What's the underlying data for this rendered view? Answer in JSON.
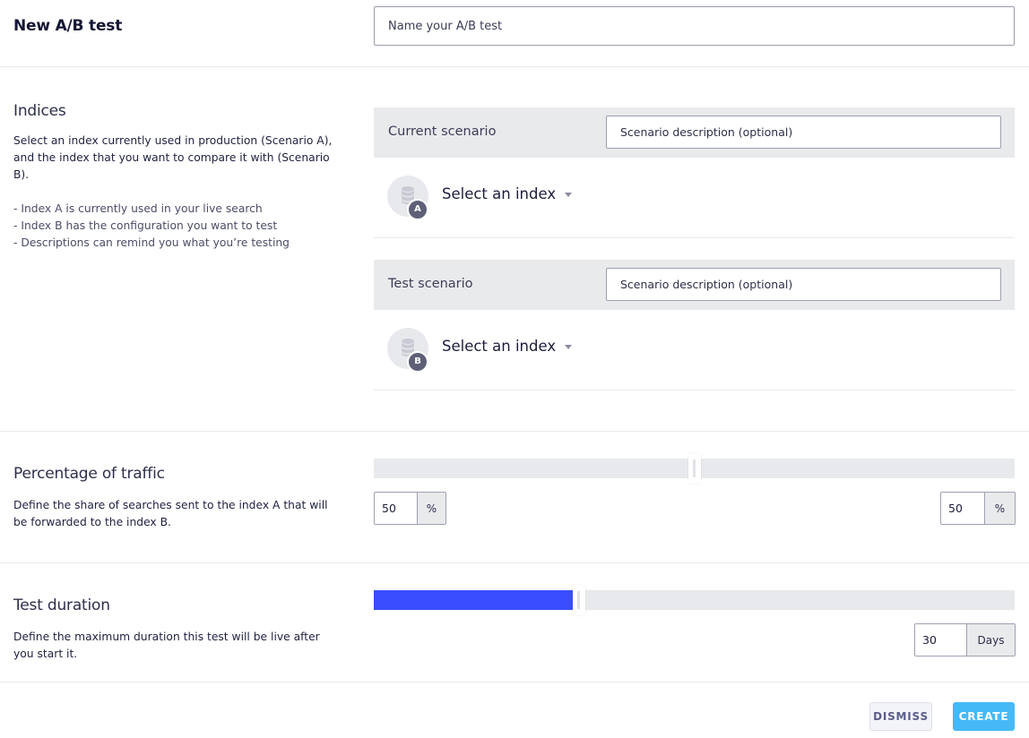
{
  "header": {
    "title": "New A/B test",
    "name_placeholder": "Name your A/B test",
    "name_value": ""
  },
  "indices": {
    "title": "Indices",
    "description": "Select an index currently used in production (Scenario A), and the index that you want to compare it with (Scenario B).",
    "bullets": [
      "- Index A is currently used in your live search",
      "- Index B has the configuration you want to test",
      "- Descriptions can remind you what you’re testing"
    ],
    "scenarios": [
      {
        "label": "Current scenario",
        "description_placeholder": "Scenario description (optional)",
        "badge": "A",
        "icon": "database-icon",
        "select_label": "Select an index"
      },
      {
        "label": "Test scenario",
        "description_placeholder": "Scenario description (optional)",
        "badge": "B",
        "icon": "database-icon",
        "select_label": "Select an index"
      }
    ]
  },
  "traffic": {
    "title": "Percentage of traffic",
    "description": "Define the share of searches sent to the index A that will be forwarded to the index B.",
    "slider_fraction": 0.5,
    "a_value": "50",
    "b_value": "50",
    "unit": "%"
  },
  "duration": {
    "title": "Test duration",
    "description": "Define the maximum duration this test will be live after you start it.",
    "slider_fraction": 0.32,
    "value": "30",
    "unit": "Days",
    "fill_color": "#3a4dff"
  },
  "actions": {
    "dismiss_label": "DISMISS",
    "create_label": "CREATE",
    "create_color": "#45b9f7"
  }
}
